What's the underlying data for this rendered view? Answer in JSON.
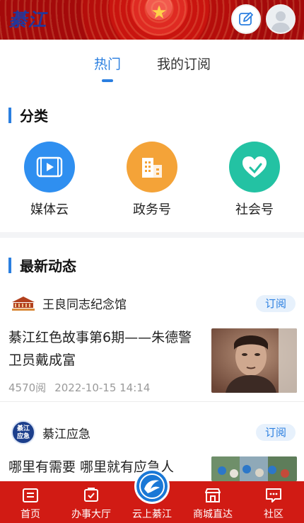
{
  "header": {
    "logo_text": "綦江",
    "edit_icon": "edit-icon",
    "avatar_icon": "avatar-icon",
    "star_glyph": "★"
  },
  "tabs": [
    {
      "label": "热门",
      "active": true
    },
    {
      "label": "我的订阅",
      "active": false
    }
  ],
  "categories": {
    "title": "分类",
    "items": [
      {
        "label": "媒体云",
        "icon": "video-icon",
        "color": "#2f8ff0"
      },
      {
        "label": "政务号",
        "icon": "building-icon",
        "color": "#f4a338"
      },
      {
        "label": "社会号",
        "icon": "heart-icon",
        "color": "#23c2a3"
      }
    ]
  },
  "news": {
    "title": "最新动态",
    "items": [
      {
        "source": "王良同志纪念馆",
        "subscribe_label": "订阅",
        "headline": "綦江红色故事第6期——朱德警卫员戴成富",
        "views": "4570阅",
        "time": "2022-10-15 14:14"
      },
      {
        "source": "綦江应急",
        "source_logo_text": "綦江应急",
        "subscribe_label": "订阅",
        "headline": "哪里有需要 哪里就有应急人"
      }
    ]
  },
  "bottom_nav": [
    {
      "label": "首页",
      "icon": "home-icon"
    },
    {
      "label": "办事大厅",
      "icon": "service-hall-icon"
    },
    {
      "label": "云上綦江",
      "icon": "cloud-qijiang-icon"
    },
    {
      "label": "商城直达",
      "icon": "shop-icon"
    },
    {
      "label": "社区",
      "icon": "community-icon"
    }
  ],
  "colors": {
    "accent": "#2b7fe0",
    "header_red": "#c9140f",
    "nav_red": "#d11b14"
  }
}
